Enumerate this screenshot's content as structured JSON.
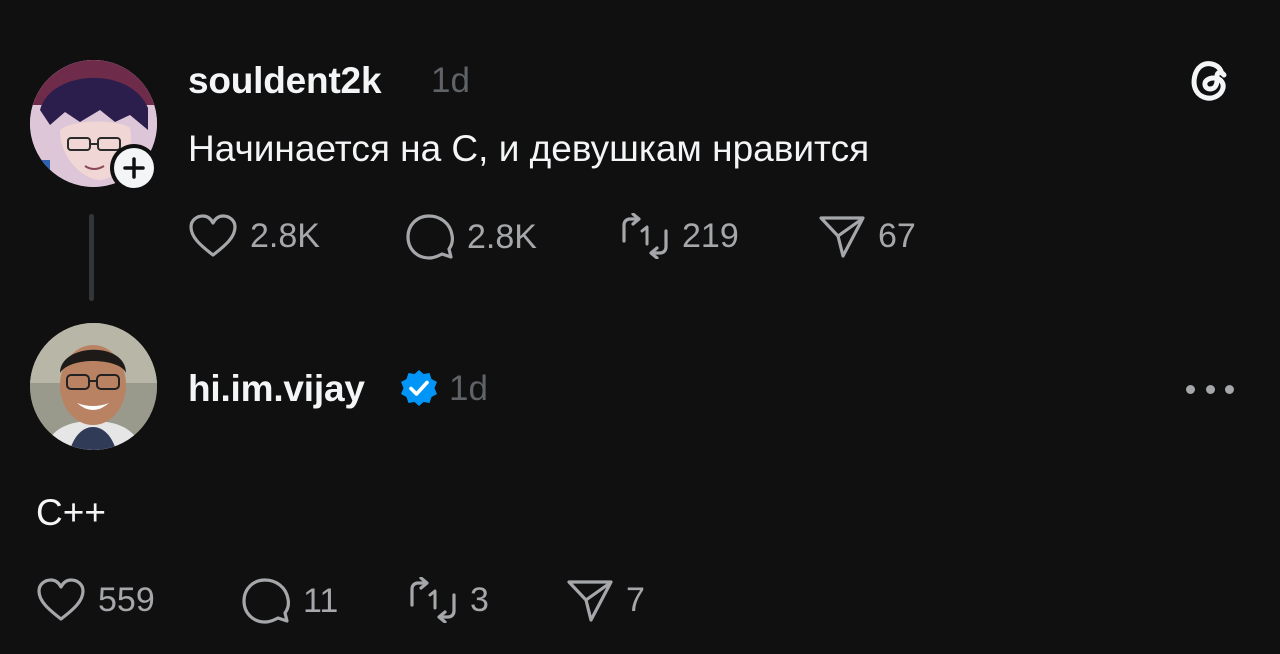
{
  "post1": {
    "username": "souldent2k",
    "time": "1d",
    "text": "Начинается на С, и девушкам нравится",
    "likes": "2.8K",
    "replies": "2.8K",
    "reposts": "219",
    "shares": "67"
  },
  "post2": {
    "username": "hi.im.vijay",
    "verified": true,
    "time": "1d",
    "text": "C++",
    "likes": "559",
    "replies": "11",
    "reposts": "3",
    "shares": "7"
  },
  "icons": {
    "app_logo": "threads-logo-icon",
    "follow": "plus-icon",
    "like": "heart-icon",
    "reply": "comment-icon",
    "repost": "repost-icon",
    "share": "send-icon",
    "verified": "verified-badge-icon",
    "more": "more-horizontal-icon"
  },
  "colors": {
    "background": "#101010",
    "primary_text": "#f3f5f7",
    "secondary_text": "#a5a7aa",
    "timestamp": "#5f6266",
    "verified_blue": "#0095f6",
    "thread_line": "#333638"
  }
}
